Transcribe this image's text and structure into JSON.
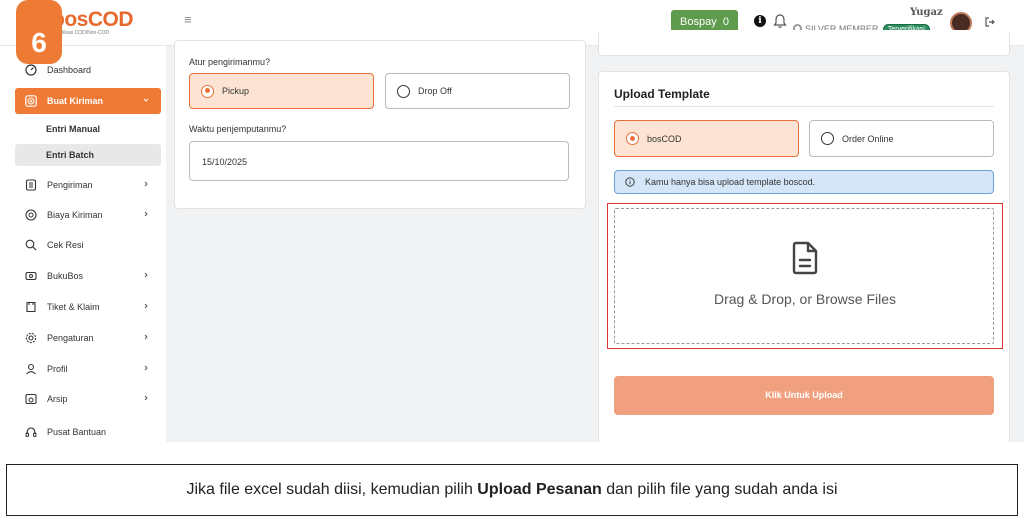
{
  "header": {
    "logo_text": "bosCOD",
    "logo_sub": "Aplikasi COD/Non-COD",
    "step_number": "6",
    "bospay_label": "Bospay",
    "bospay_value": "0",
    "username": "Yugaz",
    "member_level": "SILVER MEMBER",
    "verified_badge": "Terverifikasi"
  },
  "sidebar": {
    "items": [
      {
        "label": "Dashboard",
        "icon": "dashboard-icon"
      },
      {
        "label": "Buat Kiriman",
        "icon": "add-circle-icon",
        "active": true
      },
      {
        "label": "Entri Manual",
        "sub": true
      },
      {
        "label": "Entri Batch",
        "sub": true,
        "selected": true
      },
      {
        "label": "Pengiriman",
        "icon": "shipment-icon"
      },
      {
        "label": "Biaya Kiriman",
        "icon": "cost-icon"
      },
      {
        "label": "Cek Resi",
        "icon": "search-receipt-icon"
      },
      {
        "label": "BukuBos",
        "icon": "book-icon"
      },
      {
        "label": "Tiket & Klaim",
        "icon": "ticket-icon"
      },
      {
        "label": "Pengaturan",
        "icon": "settings-icon"
      },
      {
        "label": "Profil",
        "icon": "profile-icon"
      },
      {
        "label": "Arsip",
        "icon": "archive-icon"
      },
      {
        "label": "Pusat Bantuan",
        "icon": "help-icon"
      }
    ]
  },
  "shipping_form": {
    "method_label": "Atur pengirimanmu?",
    "method_options": [
      "Pickup",
      "Drop Off"
    ],
    "method_selected": "Pickup",
    "pickup_time_label": "Waktu penjemputanmu?",
    "pickup_date": "15/10/2025"
  },
  "upload_panel": {
    "title": "Upload Template",
    "template_options": [
      "bosCOD",
      "Order Online"
    ],
    "template_selected": "bosCOD",
    "alert_text": "Kamu hanya bisa upload template boscod.",
    "dropzone_text": "Drag & Drop, or Browse Files",
    "upload_button": "Klik Untuk Upload"
  },
  "caption": {
    "before": "Jika file excel sudah diisi, kemudian pilih ",
    "bold": "Upload Pesanan",
    "after": " dan pilih file yang sudah anda isi"
  },
  "colors": {
    "accent": "#ef7a36",
    "bospay_green": "#5e9b4d",
    "selected_bg": "#fde3d3",
    "alert_bg": "#d4e6f7",
    "upload_button_bg": "#f1a07f",
    "highlight_red": "#e03434"
  }
}
